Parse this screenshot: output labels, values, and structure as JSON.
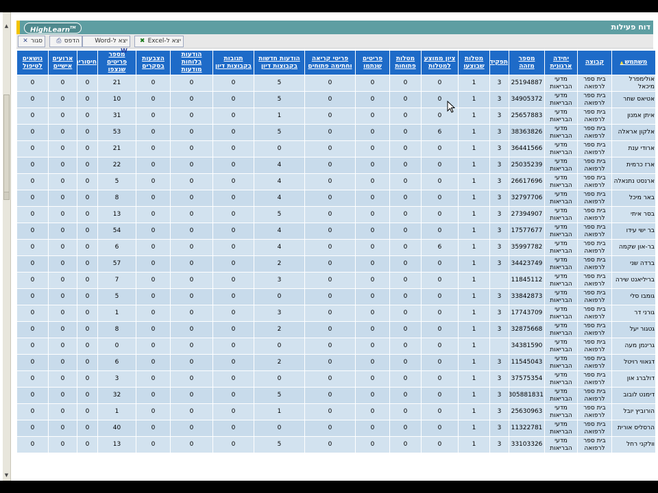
{
  "title": "דוח פעילות",
  "logo": "HighLearn",
  "logo_tm": "TM",
  "toolbar": {
    "close": "סגור",
    "print": "הדפס",
    "word": "יצא ל-Word",
    "excel": "יצא ל-Excel"
  },
  "icons": {
    "close": "close-icon",
    "print": "printer-icon",
    "word": "word-icon",
    "excel": "excel-icon",
    "sort": "sort-up-icon",
    "cursor": "mouse-pointer-icon"
  },
  "colors": {
    "header_bg": "#1e6bc8",
    "row_bg": "#c8dbeb",
    "title_bg": "#5e9ea2",
    "accent": "#f3c300"
  },
  "columns": [
    "משתמש",
    "קבוצה",
    "יחידה ארגונית",
    "מספר מזהה",
    "תפקיד",
    "מטלות שבוצעו",
    "ציון ממוצע למטלות",
    "מטלות פתוחות",
    "פריטים שנתמו",
    "פריטי קריאה וחתימה פתוחים",
    "הודעות חדשות בקבוצות דיון",
    "תגובות בקבוצות דיון",
    "הודעות בלוחות מודעות",
    "הצבעות בסקרים",
    "מספר פריטים שנצפו",
    "חיסורים",
    "ארועים אישיים",
    "נושאים לטיפול"
  ],
  "rows": [
    [
      "אולימפרל מיכאל",
      "בית ספר לרפואה",
      "מדעי הבריאות",
      "25194887",
      "3",
      "1",
      "0",
      "0",
      "0",
      "0",
      "5",
      "0",
      "0",
      "0",
      "21",
      "0",
      "0",
      "0"
    ],
    [
      "אטיאס שחר",
      "בית ספר לרפואה",
      "מדעי הבריאות",
      "34905372",
      "3",
      "1",
      "0",
      "0",
      "0",
      "0",
      "5",
      "0",
      "0",
      "0",
      "10",
      "0",
      "0",
      "0"
    ],
    [
      "איתן אמנון",
      "בית ספר לרפואה",
      "מדעי הבריאות",
      "25657883",
      "3",
      "1",
      "0",
      "0",
      "0",
      "0",
      "1",
      "0",
      "0",
      "0",
      "31",
      "0",
      "0",
      "0"
    ],
    [
      "אלקון אראלה",
      "בית ספר לרפואה",
      "מדעי הבריאות",
      "38363826",
      "3",
      "1",
      "6",
      "0",
      "0",
      "0",
      "5",
      "0",
      "0",
      "0",
      "53",
      "0",
      "0",
      "0"
    ],
    [
      "ארודי ענת",
      "בית ספר לרפואה",
      "מדעי הבריאות",
      "36441566",
      "3",
      "1",
      "0",
      "0",
      "0",
      "0",
      "0",
      "0",
      "0",
      "0",
      "21",
      "0",
      "0",
      "0"
    ],
    [
      "ארז כרמית",
      "בית ספר לרפואה",
      "מדעי הבריאות",
      "25035239",
      "3",
      "1",
      "0",
      "0",
      "0",
      "0",
      "4",
      "0",
      "0",
      "0",
      "22",
      "0",
      "0",
      "0"
    ],
    [
      "ארנסט נתנאלה",
      "בית ספר לרפואה",
      "מדעי הבריאות",
      "26617696",
      "3",
      "1",
      "0",
      "0",
      "0",
      "0",
      "4",
      "0",
      "0",
      "0",
      "5",
      "0",
      "0",
      "0"
    ],
    [
      "באר מיכל",
      "בית ספר לרפואה",
      "מדעי הבריאות",
      "32797706",
      "3",
      "1",
      "0",
      "0",
      "0",
      "0",
      "4",
      "0",
      "0",
      "0",
      "8",
      "0",
      "0",
      "0"
    ],
    [
      "בסר איתי",
      "בית ספר לרפואה",
      "מדעי הבריאות",
      "27394907",
      "3",
      "1",
      "0",
      "0",
      "0",
      "0",
      "5",
      "0",
      "0",
      "0",
      "13",
      "0",
      "0",
      "0"
    ],
    [
      "בר ישי עידו",
      "בית ספר לרפואה",
      "מדעי הבריאות",
      "17577677",
      "3",
      "1",
      "0",
      "0",
      "0",
      "0",
      "4",
      "0",
      "0",
      "0",
      "54",
      "0",
      "0",
      "0"
    ],
    [
      "בר-און שקמה",
      "בית ספר לרפואה",
      "מדעי הבריאות",
      "35997782",
      "3",
      "1",
      "6",
      "0",
      "0",
      "0",
      "4",
      "0",
      "0",
      "0",
      "6",
      "0",
      "0",
      "0"
    ],
    [
      "ברדה שני",
      "בית ספר לרפואה",
      "מדעי הבריאות",
      "34423749",
      "3",
      "1",
      "0",
      "0",
      "0",
      "0",
      "2",
      "0",
      "0",
      "0",
      "57",
      "0",
      "0",
      "0"
    ],
    [
      "בריליאנט שירה",
      "בית ספר לרפואה",
      "מדעי הבריאות",
      "11845112",
      "",
      "1",
      "0",
      "0",
      "0",
      "0",
      "3",
      "0",
      "0",
      "0",
      "7",
      "0",
      "0",
      "0"
    ],
    [
      "גומבו סלי",
      "בית ספר לרפואה",
      "מדעי הבריאות",
      "33842873",
      "3",
      "1",
      "0",
      "0",
      "0",
      "0",
      "0",
      "0",
      "0",
      "0",
      "5",
      "0",
      "0",
      "0"
    ],
    [
      "גורני דר",
      "בית ספר לרפואה",
      "מדעי הבריאות",
      "17743709",
      "3",
      "1",
      "0",
      "0",
      "0",
      "0",
      "3",
      "0",
      "0",
      "0",
      "1",
      "0",
      "0",
      "0"
    ],
    [
      "גטגור יעל",
      "בית ספר לרפואה",
      "מדעי הבריאות",
      "32875668",
      "3",
      "1",
      "0",
      "0",
      "0",
      "0",
      "2",
      "0",
      "0",
      "0",
      "8",
      "0",
      "0",
      "0"
    ],
    [
      "גרינמן מעה",
      "בית ספר לרפואה",
      "מדעי הבריאות",
      "34381590",
      "",
      "1",
      "0",
      "0",
      "0",
      "0",
      "0",
      "0",
      "0",
      "0",
      "0",
      "0",
      "0",
      "0"
    ],
    [
      "דגאווי רויטל",
      "בית ספר לרפואה",
      "מדעי הבריאות",
      "11545043",
      "3",
      "1",
      "0",
      "0",
      "0",
      "0",
      "2",
      "0",
      "0",
      "0",
      "6",
      "0",
      "0",
      "0"
    ],
    [
      "דולברג און",
      "בית ספר לרפואה",
      "מדעי הבריאות",
      "37575354",
      "3",
      "1",
      "0",
      "0",
      "0",
      "0",
      "0",
      "0",
      "0",
      "0",
      "3",
      "0",
      "0",
      "0"
    ],
    [
      "דימנט לובוב",
      "בית ספר לרפואה",
      "מדעי הבריאות",
      "305881831",
      "3",
      "1",
      "0",
      "0",
      "0",
      "0",
      "5",
      "0",
      "0",
      "0",
      "32",
      "0",
      "0",
      "0"
    ],
    [
      "הורוביץ יובל",
      "בית ספר לרפואה",
      "מדעי הבריאות",
      "25630963",
      "3",
      "1",
      "0",
      "0",
      "0",
      "0",
      "1",
      "0",
      "0",
      "0",
      "1",
      "0",
      "0",
      "0"
    ],
    [
      "הרסליס אורית",
      "בית ספר לרפואה",
      "מדעי הבריאות",
      "11322781",
      "3",
      "1",
      "0",
      "0",
      "0",
      "0",
      "0",
      "0",
      "0",
      "0",
      "40",
      "0",
      "0",
      "0"
    ],
    [
      "וולקני רחל",
      "בית ספר לרפואה",
      "מדעי הבריאות",
      "33103326",
      "3",
      "1",
      "0",
      "0",
      "0",
      "0",
      "5",
      "0",
      "0",
      "0",
      "13",
      "0",
      "0",
      "0"
    ]
  ]
}
